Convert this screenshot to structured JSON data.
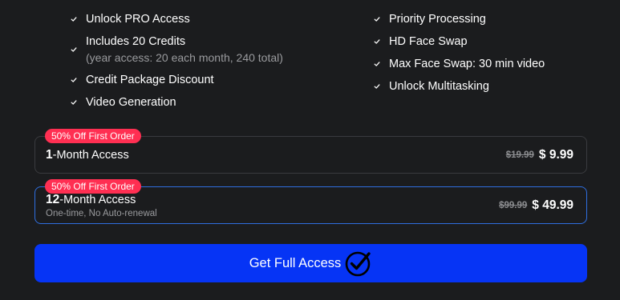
{
  "features": {
    "left": [
      {
        "text": "Unlock PRO Access"
      },
      {
        "text": "Includes 20 Credits",
        "sub": "(year access: 20 each month, 240 total)"
      },
      {
        "text": "Credit Package Discount"
      },
      {
        "text": "Video Generation"
      }
    ],
    "right": [
      {
        "text": "Priority Processing"
      },
      {
        "text": "HD Face Swap"
      },
      {
        "text": "Max Face Swap: 30 min video"
      },
      {
        "text": "Unlock Multitasking"
      }
    ]
  },
  "plans": [
    {
      "badge": "50% Off First Order",
      "months": "1",
      "label": "-Month Access",
      "note": "",
      "old_price": "$19.99",
      "new_price": "$ 9.99",
      "selected": false
    },
    {
      "badge": "50% Off First Order",
      "months": "12",
      "label": "-Month Access",
      "note": "One-time, No Auto-renewal",
      "old_price": "$99.99",
      "new_price": "$ 49.99",
      "selected": true
    }
  ],
  "cta": {
    "label": "Get Full Access",
    "icon": "check-circle-icon"
  },
  "colors": {
    "background": "#1b1c1e",
    "badge": "#ff2f52",
    "selected_border": "#2f6fe0",
    "cta": "#0634f5"
  }
}
